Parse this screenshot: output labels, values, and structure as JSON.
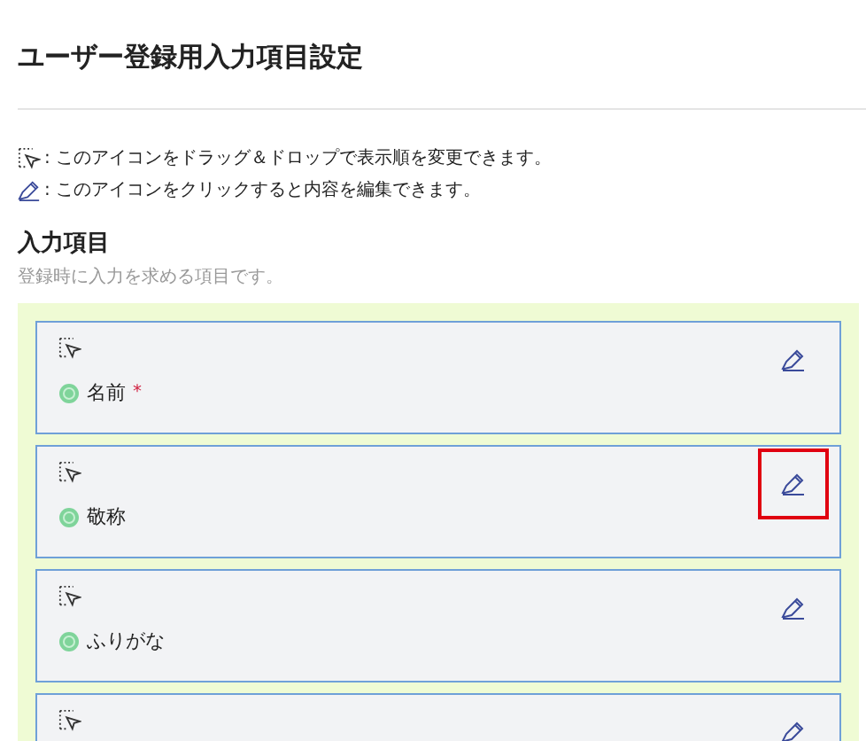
{
  "page": {
    "title": "ユーザー登録用入力項目設定"
  },
  "legend": [
    {
      "kind": "drag",
      "text": ": このアイコンをドラッグ＆ドロップで表示順を変更できます。"
    },
    {
      "kind": "edit",
      "text": ": このアイコンをクリックすると内容を編集できます。"
    }
  ],
  "section": {
    "heading": "入力項目",
    "description": "登録時に入力を求める項目です。"
  },
  "items": [
    {
      "name": "名前",
      "required_mark": "*",
      "highlighted": false
    },
    {
      "name": "敬称",
      "highlighted": true
    },
    {
      "name": "ふりがな",
      "highlighted": false
    },
    {
      "highlighted": false
    }
  ]
}
